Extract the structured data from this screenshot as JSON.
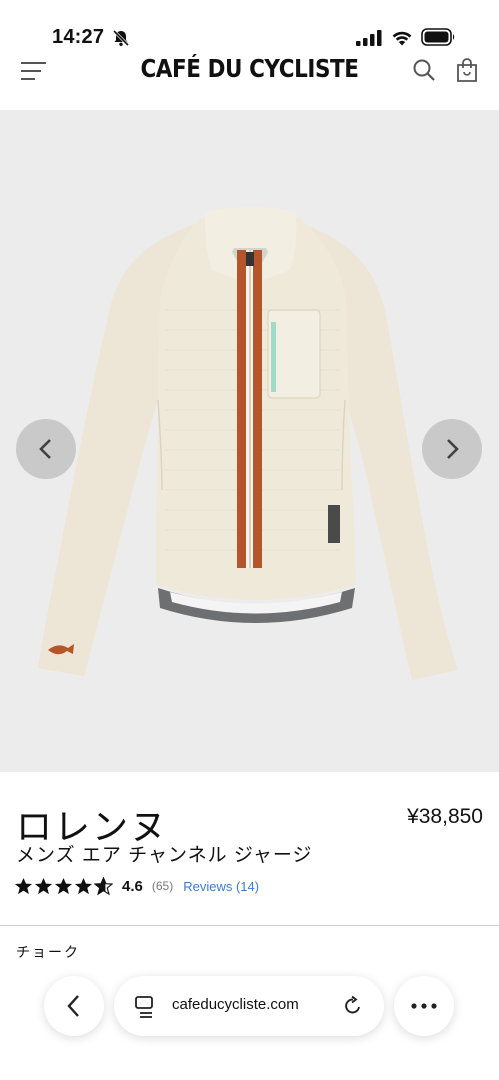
{
  "status_bar": {
    "time": "14:27"
  },
  "header": {
    "brand": "CAFÉ DU CYCLISTE"
  },
  "product": {
    "name": "ロレンヌ",
    "subtitle": "メンズ エア チャンネル ジャージ",
    "price": "¥38,850",
    "rating_value": "4.6",
    "rating_count": "(65)",
    "reviews_label": "Reviews (14)",
    "stars_filled_fraction": 0.92,
    "color_label": "チョーク"
  },
  "browser": {
    "url": "cafeducycliste.com"
  },
  "colors": {
    "accent_link": "#3a7bd5",
    "stripe": "#b5562a",
    "jersey": "#ede6d6",
    "background": "#ececec"
  },
  "icons": [
    "bell-off-icon",
    "signal-icon",
    "wifi-icon",
    "battery-icon",
    "menu-icon",
    "search-icon",
    "bag-icon",
    "chevron-left-icon",
    "chevron-right-icon",
    "tabs-icon",
    "reload-icon",
    "more-icon"
  ]
}
